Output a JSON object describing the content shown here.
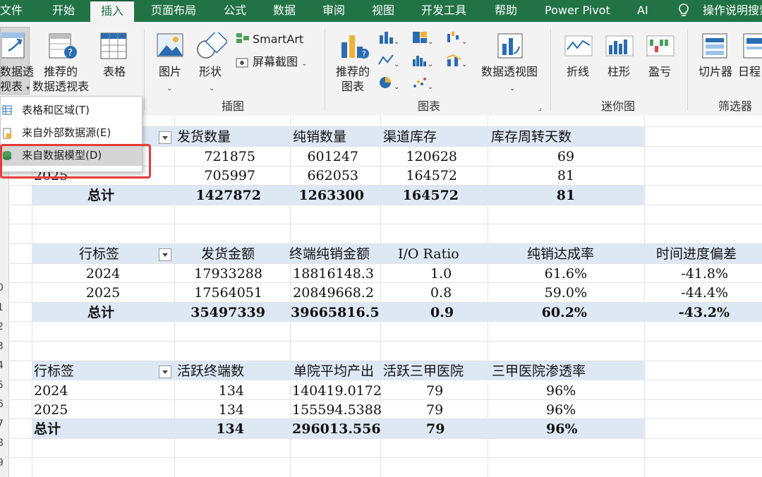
{
  "tabs": [
    "文件",
    "开始",
    "插入",
    "页面布局",
    "公式",
    "数据",
    "审阅",
    "视图",
    "开发工具",
    "帮助",
    "Power Pivot",
    "AI",
    "操作说明搜索"
  ],
  "active_tab": "插入",
  "ribbon": {
    "pivot_btn": {
      "line1": "数据透",
      "line2": "视表"
    },
    "recommended_pivot": {
      "line1": "推荐的",
      "line2": "数据透视表"
    },
    "table_btn": "表格",
    "picture_btn": "图片",
    "shapes_btn": "形状",
    "smartart_btn": "SmartArt",
    "screenshot_btn": "屏幕截图",
    "illustrations_group": "插图",
    "recommended_charts": {
      "line1": "推荐的",
      "line2": "图表"
    },
    "pivot_chart_btn": "数据透视图",
    "charts_group": "图表",
    "sparkline_line": "折线",
    "sparkline_column": "柱形",
    "sparkline_winloss": "盈亏",
    "sparklines_group": "迷你图",
    "slicer_btn": "切片器",
    "timeline_btn": "日程",
    "filters_group": "筛选器"
  },
  "menu": {
    "items": [
      "表格和区域(T)",
      "来自外部数据源(E)",
      "来自数据模型(D)"
    ],
    "selected": "来自数据模型(D)"
  },
  "rows": [
    "",
    "",
    "",
    "",
    "",
    "",
    "",
    "0",
    "1",
    "2",
    "3",
    "4",
    "5",
    "6",
    "7",
    "8",
    "9"
  ],
  "pivot1": {
    "headers": [
      "发货数量",
      "纯销数量",
      "渠道库存",
      "库存周转天数"
    ],
    "rows": [
      {
        "label": "",
        "values": [
          "721875",
          "601247",
          "120628",
          "69"
        ]
      },
      {
        "label": "2025",
        "values": [
          "705997",
          "662053",
          "164572",
          "81"
        ]
      }
    ],
    "total": {
      "label": "总计",
      "values": [
        "1427872",
        "1263300",
        "164572",
        "81"
      ]
    }
  },
  "pivot2": {
    "row_label": "行标签",
    "headers": [
      "发货金额",
      "终端纯销金额",
      "I/O Ratio",
      "纯销达成率",
      "时间进度偏差"
    ],
    "rows": [
      {
        "label": "2024",
        "values": [
          "17933288",
          "18816148.3",
          "1.0",
          "61.6%",
          "-41.8%"
        ]
      },
      {
        "label": "2025",
        "values": [
          "17564051",
          "20849668.2",
          "0.8",
          "59.0%",
          "-44.4%"
        ]
      }
    ],
    "total": {
      "label": "总计",
      "values": [
        "35497339",
        "39665816.5",
        "0.9",
        "60.2%",
        "-43.2%"
      ]
    }
  },
  "pivot3": {
    "row_label": "行标签",
    "headers": [
      "活跃终端数",
      "单院平均产出",
      "活跃三甲医院",
      "三甲医院渗透率"
    ],
    "rows": [
      {
        "label": "2024",
        "values": [
          "134",
          "140419.0172",
          "79",
          "96%"
        ]
      },
      {
        "label": "2025",
        "values": [
          "134",
          "155594.5388",
          "79",
          "96%"
        ]
      }
    ],
    "total": {
      "label": "总计",
      "values": [
        "134",
        "296013.556",
        "79",
        "96%"
      ]
    }
  },
  "colors": {
    "excel_green": "#217346",
    "band": "#dde8f4",
    "highlight": "#e63b3b"
  }
}
